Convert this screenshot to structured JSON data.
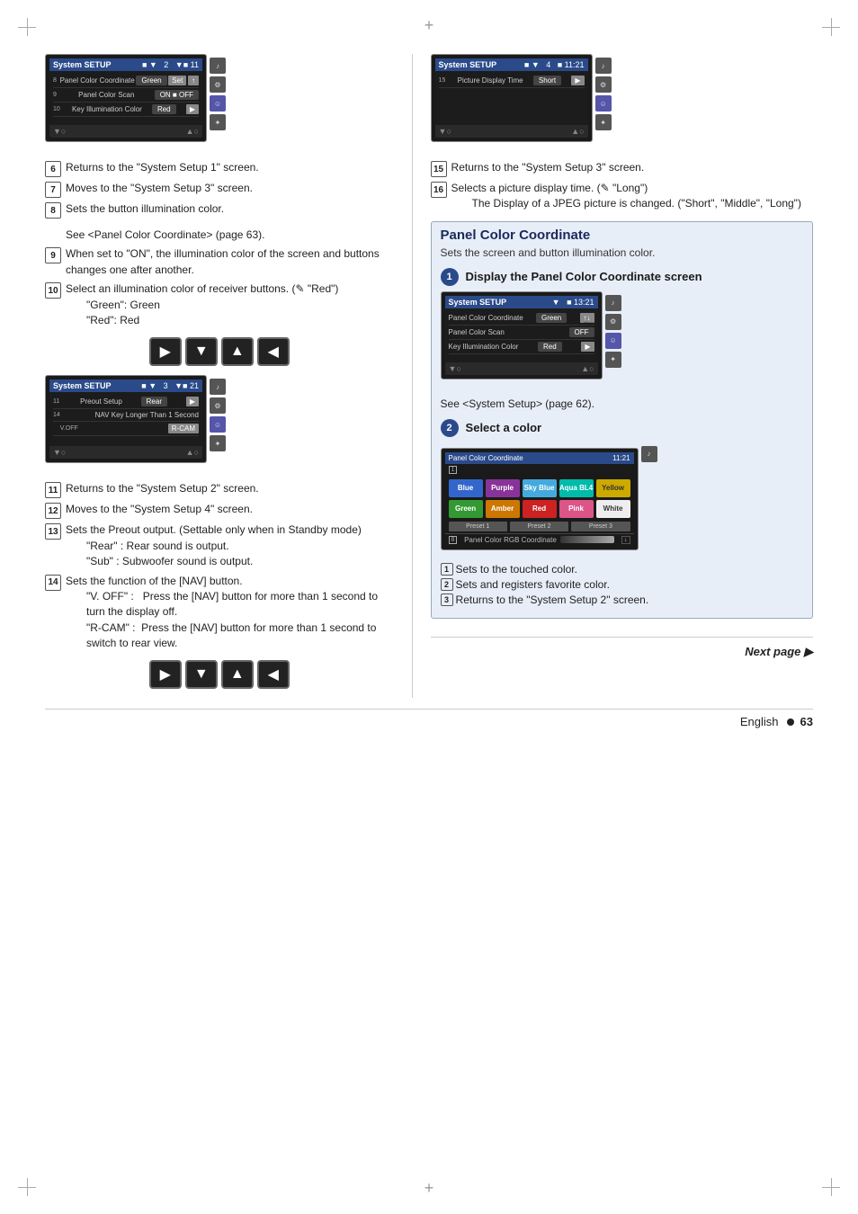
{
  "page": {
    "language": "English",
    "page_number": "63",
    "next_page_label": "Next page ▶"
  },
  "left_col": {
    "screens": [
      {
        "id": "screen1",
        "header_title": "System SETUP",
        "header_icons": "■ ▼",
        "header_num": "2",
        "rows": [
          {
            "number": "8",
            "label": "Panel Color Coordinate",
            "value": "Green",
            "btn": "Set",
            "btn2": "↑"
          },
          {
            "number": "9",
            "label": "Panel Color Scan",
            "value": "ON ■ OFF"
          },
          {
            "number": "10",
            "label": "Key Illumination Color",
            "value": "Red",
            "btn": "▶"
          }
        ]
      },
      {
        "id": "screen2",
        "header_title": "System SETUP",
        "header_num": "3",
        "rows": [
          {
            "number": "11",
            "label": "Preout Setup",
            "value": "Rear",
            "btn": "▶"
          },
          {
            "number": "14",
            "label": "NAV Key Longer Than 1 Second",
            "value": "V.OFF",
            "btn": "R-CAM"
          }
        ]
      }
    ],
    "items": [
      {
        "id": "6",
        "text": "Returns to the \"System Setup 1\" screen."
      },
      {
        "id": "7",
        "text": "Moves to the \"System Setup 3\" screen."
      },
      {
        "id": "8",
        "text": "Sets the button illumination color.",
        "sub": "See <Panel Color Coordinate> (page 63)."
      },
      {
        "id": "9",
        "text": "When set to \"ON\", the illumination color of the screen and buttons changes one after another."
      },
      {
        "id": "10",
        "text": "Select an illumination color of receiver buttons. (✎ \"Red\")",
        "sub1": "\"Green\": Green",
        "sub2": "\"Red\": Red"
      }
    ],
    "items2": [
      {
        "id": "11",
        "text": "Returns to the \"System Setup 2\" screen."
      },
      {
        "id": "12",
        "text": "Moves to the \"System Setup 4\" screen."
      },
      {
        "id": "13",
        "text": "Sets the Preout output. (Settable only when in Standby mode)",
        "sub1": "\"Rear\" : Rear sound is output.",
        "sub2": "\"Sub\" : Subwoofer sound is output."
      },
      {
        "id": "14",
        "text": "Sets the function of the [NAV] button.",
        "sub1": "\"V. OFF\" :   Press the [NAV] button for more than 1 second to turn the display off.",
        "sub2": "\"R-CAM\" :  Press the [NAV] button for more than 1 second to switch to rear view."
      }
    ],
    "nav_arrows": [
      "▶",
      "▼",
      "▲",
      "◀"
    ]
  },
  "right_col": {
    "screens": [
      {
        "id": "screen3",
        "header_title": "System SETUP",
        "header_num": "4",
        "header_time": "11:21",
        "rows": [
          {
            "number": "15",
            "label": "Picture Display Time",
            "value": "Short",
            "btn": "▶"
          }
        ]
      }
    ],
    "items": [
      {
        "id": "15",
        "text": "Returns to the \"System Setup 3\" screen."
      },
      {
        "id": "16",
        "text": "Selects a picture display time. (✎ \"Long\")",
        "sub": "The Display of a JPEG picture is changed. (\"Short\", \"Middle\", \"Long\")"
      }
    ],
    "panel_section": {
      "title": "Panel Color Coordinate",
      "subtitle": "Sets the screen and button illumination color.",
      "step1": {
        "number": "1",
        "title": "Display the Panel Color Coordinate screen",
        "screen": {
          "header_title": "System SETUP",
          "rows": [
            {
              "label": "Panel Color Coordinate",
              "value": "Green"
            },
            {
              "label": "Panel Color Scan"
            },
            {
              "label": "Key Illumination Color",
              "value": "Red",
              "btn": "▶"
            }
          ]
        },
        "see_text": "See <System Setup> (page 62)."
      },
      "step2": {
        "number": "2",
        "title": "Select a color",
        "colors": [
          {
            "name": "Blue",
            "css": "#3366cc"
          },
          {
            "name": "Purple",
            "css": "#883399"
          },
          {
            "name": "Sky Blue",
            "css": "#44aadd"
          },
          {
            "name": "Aqua BL4",
            "css": "#00bbaa"
          },
          {
            "name": "Yellow",
            "css": "#ccaa00"
          },
          {
            "name": "Green",
            "css": "#339933"
          },
          {
            "name": "Amber",
            "css": "#cc7700"
          },
          {
            "name": "Red",
            "css": "#cc2222"
          },
          {
            "name": "Pink",
            "css": "#dd5588"
          },
          {
            "name": "White",
            "css": "#eeeeee"
          }
        ],
        "presets": [
          "Preset 1",
          "Preset 2",
          "Preset 3"
        ],
        "rgb_label": "Panel Color RGB Coordinate",
        "result_items": [
          {
            "num": "1",
            "text": "Sets to the touched color."
          },
          {
            "num": "2",
            "text": "Sets and registers favorite color."
          },
          {
            "num": "3",
            "text": "Returns to the \"System Setup 2\" screen."
          }
        ]
      }
    }
  }
}
